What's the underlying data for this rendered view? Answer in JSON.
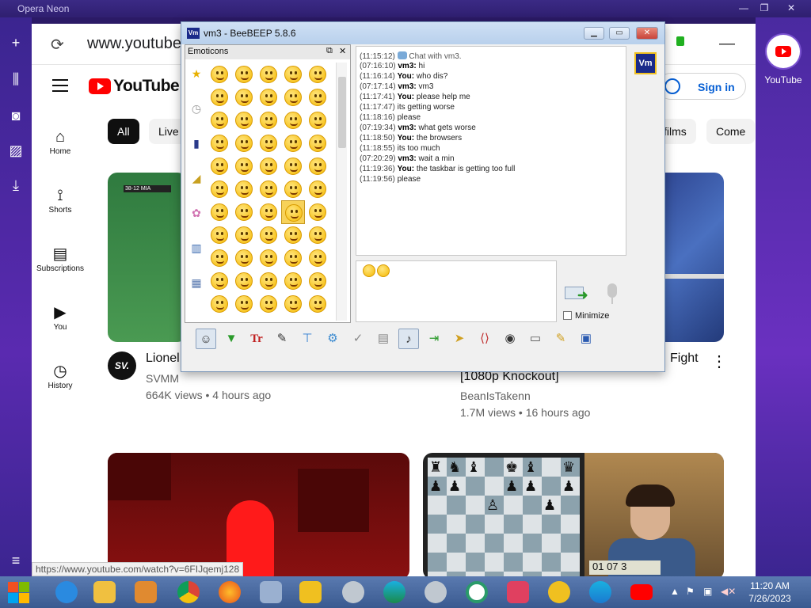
{
  "opera": {
    "title": "Opera Neon",
    "right_app_label": "YouTube"
  },
  "browser": {
    "url": "www.youtube",
    "status_url": "https://www.youtube.com/watch?v=6FIJqemj128"
  },
  "youtube": {
    "logo_text": "YouTube",
    "sign_in": "Sign in",
    "nav": [
      {
        "label": "Home",
        "icon": "home-icon"
      },
      {
        "label": "Shorts",
        "icon": "shorts-icon"
      },
      {
        "label": "Subscriptions",
        "icon": "subscriptions-icon"
      },
      {
        "label": "You",
        "icon": "you-icon"
      },
      {
        "label": "History",
        "icon": "history-icon"
      }
    ],
    "chips": [
      "All",
      "Live",
      "films",
      "Come"
    ],
    "videos": [
      {
        "title": "Lionel",
        "channel": "SVMM",
        "meta": "664K views • 4 hours ago",
        "avatar_text": "SV."
      },
      {
        "title": "Fight",
        "title_line2": "[1080p Knockout]",
        "channel": "BeanIsTakenn",
        "meta": "1.7M views • 16 hours ago"
      }
    ],
    "thumb_score": "38-12  MIA",
    "chess_clock": "01 07 3"
  },
  "beebeep": {
    "title": "vm3 - BeeBEEP 5.8.6",
    "icon_text": "Vm",
    "emoticons_header": "Emoticons",
    "minimize_label": "Minimize",
    "badge": "Vm",
    "chat": [
      {
        "ts": "(11:15:12)",
        "who": "",
        "text": "Chat with vm3.",
        "system": true
      },
      {
        "ts": "(07:16:10)",
        "who": "vm3:",
        "text": "hi"
      },
      {
        "ts": "(11:16:14)",
        "who": "You:",
        "text": "who dis?"
      },
      {
        "ts": "(07:17:14)",
        "who": "vm3:",
        "text": "vm3"
      },
      {
        "ts": "(11:17:41)",
        "who": "You:",
        "text": "please help me"
      },
      {
        "ts": "(11:17:47)",
        "who": "",
        "text": "its getting worse"
      },
      {
        "ts": "(11:18:16)",
        "who": "",
        "text": "please"
      },
      {
        "ts": "(07:19:34)",
        "who": "vm3:",
        "text": "what gets worse"
      },
      {
        "ts": "(11:18:50)",
        "who": "You:",
        "text": "the browsers"
      },
      {
        "ts": "(11:18:55)",
        "who": "",
        "text": "its too much"
      },
      {
        "ts": "(07:20:29)",
        "who": "vm3:",
        "text": "wait a min"
      },
      {
        "ts": "(11:19:36)",
        "who": "You:",
        "text": "the taskbar is getting too full"
      },
      {
        "ts": "(11:19:56)",
        "who": "",
        "text": "please"
      }
    ]
  },
  "taskbar": {
    "time": "11:20 AM",
    "date": "7/26/2023"
  },
  "colors": {
    "opera_purple": "#3b2590",
    "youtube_red": "#ff0000",
    "link_blue": "#065fd4",
    "taskbar_blue": "#4a6aa0"
  }
}
